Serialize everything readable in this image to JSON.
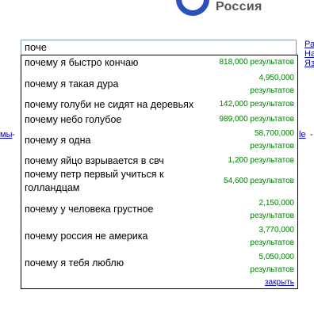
{
  "brand": {
    "name": "Россия"
  },
  "search": {
    "value": "поче"
  },
  "side_links": {
    "right_1": "Ра",
    "right_2": "На",
    "right_3": "Яз",
    "left_word": "мы",
    "left_dash": " - ",
    "right_word": "le",
    "right_dash": " -"
  },
  "suggestions": [
    {
      "query": "почему я быстро кончаю",
      "count": "818,000",
      "unit": "результатов"
    },
    {
      "query": "почему я такая дура",
      "count": "4,950,000",
      "unit": "результатов"
    },
    {
      "query": "почему голуби не сидят на деревьях",
      "count": "142,000",
      "unit": "результатов"
    },
    {
      "query": "почему небо голубое",
      "count": "989,000",
      "unit": "результатов"
    },
    {
      "query": "почему я одна",
      "count": "58,700,000",
      "unit": "результатов"
    },
    {
      "query": "почему яйцо взрывается в свч",
      "count": "1,200",
      "unit": "результатов"
    },
    {
      "query": "почему петр первый учиться к голландцам",
      "count": "54,600",
      "unit": "результатов"
    },
    {
      "query": "почему у человека грустное",
      "count": "2,150,000",
      "unit": "результатов"
    },
    {
      "query": "почему россия не америка",
      "count": "3,770,000",
      "unit": "результатов"
    },
    {
      "query": "почему я тебя люблю",
      "count": "5,050,000",
      "unit": "результатов"
    }
  ],
  "close_label": "закрыть"
}
